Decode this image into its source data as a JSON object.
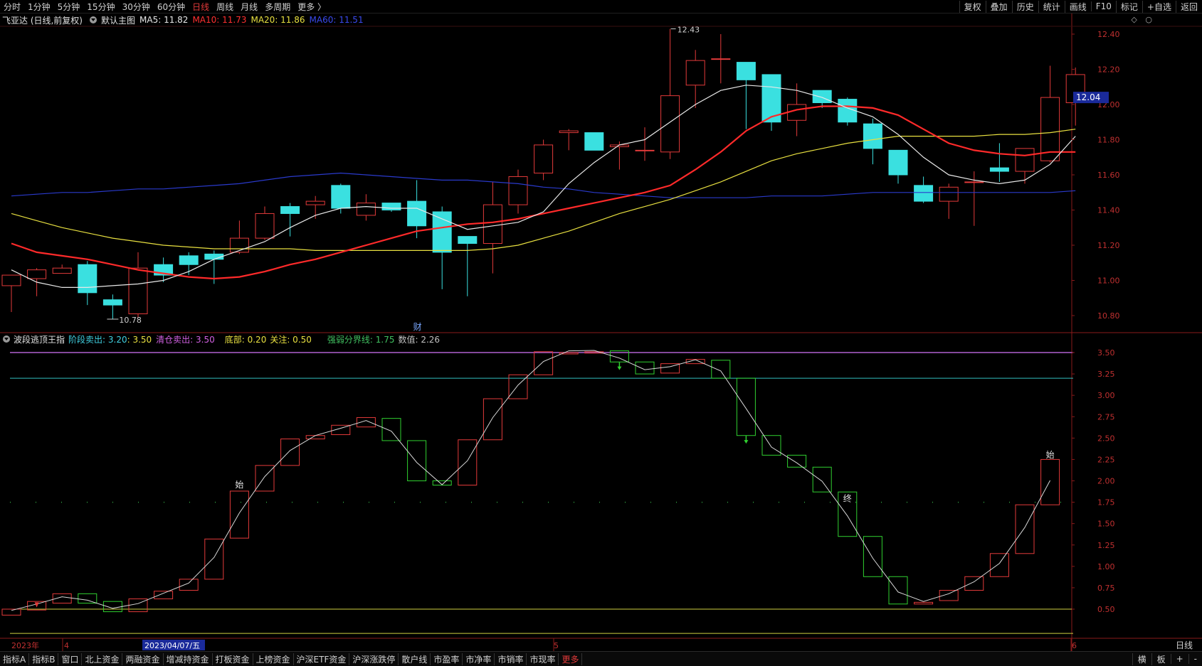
{
  "toolbar": {
    "periods": [
      "分时",
      "1分钟",
      "5分钟",
      "15分钟",
      "30分钟",
      "60分钟",
      "日线",
      "周线",
      "月线",
      "多周期",
      "更多 〉"
    ],
    "active_period": "日线",
    "right_buttons": [
      "复权",
      "叠加",
      "历史",
      "统计",
      "画线",
      "F10",
      "标记",
      "+自选",
      "返回"
    ]
  },
  "main_header": {
    "stock": "飞亚达 (日线,前复权)",
    "template": "默认主图",
    "ma5": "MA5: 11.82",
    "ma10": "MA10: 11.73",
    "ma20": "MA20: 11.86",
    "ma60": "MA60: 11.51",
    "icons": [
      "◇",
      "○"
    ]
  },
  "indicator_header": {
    "name": "波段逃顶王指",
    "stage_sell": "阶段卖出: 3.20",
    "stage_sell_b": ": 3.50",
    "clear_sell": "清仓卖出: 3.50",
    "bottom": "底部: 0.20",
    "focus": "关注: 0.50",
    "divider": "强弱分界线: 1.75",
    "value": "数值: 2.26"
  },
  "colors": {
    "up": "#e23a3a",
    "down": "#3ae0e0",
    "ma5": "#e8e8e8",
    "ma10": "#ff2a2a",
    "ma20": "#e8e040",
    "ma60": "#2a3acc",
    "ind_up": "#e23a3a",
    "ind_down": "#30d030",
    "sell_line": "#b060d0",
    "clear_line": "#30c0c0",
    "focus_line": "#d0d040"
  },
  "price_axis": {
    "ticks": [
      "12.40",
      "12.20",
      "12.00",
      "11.80",
      "11.60",
      "11.40",
      "11.20",
      "11.00",
      "10.80"
    ],
    "last_price": "12.04"
  },
  "ind_axis": {
    "ticks": [
      "3.50",
      "3.25",
      "3.00",
      "2.75",
      "2.50",
      "2.25",
      "2.00",
      "1.75",
      "1.50",
      "1.25",
      "1.00",
      "0.75",
      "0.50"
    ]
  },
  "annotations": {
    "high": "12.43",
    "low": "10.78",
    "cai": "财",
    "shi1": "始",
    "zhong": "终",
    "shi2": "始"
  },
  "date_axis": {
    "year": "2023年",
    "m4": "4",
    "cursor_date": "2023/04/07/五",
    "m5": "5",
    "m6": "6",
    "period_label": "日线"
  },
  "statusbar": {
    "items": [
      "指标A",
      "指标B",
      "窗口",
      "北上资金",
      "两融资金",
      "增减持资金",
      "打板资金",
      "上榜资金",
      "沪深ETF资金",
      "沪深涨跌停",
      "散户线",
      "市盈率",
      "市净率",
      "市销率",
      "市现率",
      "更多"
    ],
    "right": [
      "横",
      "板",
      "+",
      "-"
    ]
  },
  "chart_data": [
    {
      "type": "candlestick",
      "title": "飞亚达 (日线,前复权)",
      "ylim": [
        10.7,
        12.45
      ],
      "candles": [
        {
          "o": 10.97,
          "c": 11.03,
          "h": 11.03,
          "l": 10.82
        },
        {
          "o": 11.01,
          "c": 11.06,
          "h": 11.07,
          "l": 10.91
        },
        {
          "o": 11.04,
          "c": 11.07,
          "h": 11.09,
          "l": 11.04
        },
        {
          "o": 11.09,
          "c": 10.93,
          "h": 11.11,
          "l": 10.86
        },
        {
          "o": 10.89,
          "c": 10.86,
          "h": 10.92,
          "l": 10.78
        },
        {
          "o": 10.81,
          "c": 11.07,
          "h": 11.16,
          "l": 10.79
        },
        {
          "o": 11.09,
          "c": 11.03,
          "h": 11.13,
          "l": 10.99
        },
        {
          "o": 11.14,
          "c": 11.09,
          "h": 11.16,
          "l": 11.03
        },
        {
          "o": 11.15,
          "c": 11.12,
          "h": 11.17,
          "l": 10.98
        },
        {
          "o": 11.16,
          "c": 11.24,
          "h": 11.34,
          "l": 11.15
        },
        {
          "o": 11.24,
          "c": 11.38,
          "h": 11.42,
          "l": 11.23
        },
        {
          "o": 11.42,
          "c": 11.38,
          "h": 11.44,
          "l": 11.25
        },
        {
          "o": 11.43,
          "c": 11.45,
          "h": 11.48,
          "l": 11.35
        },
        {
          "o": 11.54,
          "c": 11.41,
          "h": 11.55,
          "l": 11.38
        },
        {
          "o": 11.37,
          "c": 11.44,
          "h": 11.49,
          "l": 11.34
        },
        {
          "o": 11.44,
          "c": 11.4,
          "h": 11.44,
          "l": 11.39
        },
        {
          "o": 11.45,
          "c": 11.31,
          "h": 11.57,
          "l": 11.24
        },
        {
          "o": 11.39,
          "c": 11.16,
          "h": 11.42,
          "l": 10.95
        },
        {
          "o": 11.25,
          "c": 11.21,
          "h": 11.25,
          "l": 10.91
        },
        {
          "o": 11.21,
          "c": 11.43,
          "h": 11.56,
          "l": 11.04
        },
        {
          "o": 11.43,
          "c": 11.59,
          "h": 11.63,
          "l": 11.38
        },
        {
          "o": 11.61,
          "c": 11.77,
          "h": 11.8,
          "l": 11.57
        },
        {
          "o": 11.84,
          "c": 11.85,
          "h": 11.86,
          "l": 11.74
        },
        {
          "o": 11.84,
          "c": 11.74,
          "h": 11.84,
          "l": 11.74
        },
        {
          "o": 11.76,
          "c": 11.77,
          "h": 11.79,
          "l": 11.63
        },
        {
          "o": 11.74,
          "c": 11.74,
          "h": 11.87,
          "l": 11.68
        },
        {
          "o": 11.73,
          "c": 12.05,
          "h": 12.43,
          "l": 11.69
        },
        {
          "o": 12.11,
          "c": 12.25,
          "h": 12.31,
          "l": 11.98
        },
        {
          "o": 12.26,
          "c": 12.26,
          "h": 12.4,
          "l": 12.12
        },
        {
          "o": 12.24,
          "c": 12.14,
          "h": 12.24,
          "l": 11.86
        },
        {
          "o": 12.17,
          "c": 11.9,
          "h": 12.17,
          "l": 11.85
        },
        {
          "o": 11.91,
          "c": 12.0,
          "h": 12.12,
          "l": 11.82
        },
        {
          "o": 12.08,
          "c": 12.01,
          "h": 12.08,
          "l": 11.98
        },
        {
          "o": 12.03,
          "c": 11.9,
          "h": 12.04,
          "l": 11.88
        },
        {
          "o": 11.89,
          "c": 11.75,
          "h": 11.92,
          "l": 11.66
        },
        {
          "o": 11.74,
          "c": 11.6,
          "h": 11.74,
          "l": 11.55
        },
        {
          "o": 11.54,
          "c": 11.45,
          "h": 11.59,
          "l": 11.44
        },
        {
          "o": 11.45,
          "c": 11.53,
          "h": 11.55,
          "l": 11.35
        },
        {
          "o": 11.56,
          "c": 11.56,
          "h": 11.62,
          "l": 11.31
        },
        {
          "o": 11.64,
          "c": 11.62,
          "h": 11.78,
          "l": 11.56
        },
        {
          "o": 11.62,
          "c": 11.75,
          "h": 11.75,
          "l": 11.55
        },
        {
          "o": 11.68,
          "c": 12.04,
          "h": 12.22,
          "l": 11.67
        },
        {
          "o": 12.01,
          "c": 12.17,
          "h": 12.21,
          "l": 11.88
        }
      ],
      "ma5": [
        11.06,
        10.99,
        10.96,
        10.96,
        10.97,
        10.98,
        11.0,
        11.05,
        11.12,
        11.17,
        11.22,
        11.3,
        11.37,
        11.41,
        11.42,
        11.41,
        11.41,
        11.35,
        11.29,
        11.31,
        11.33,
        11.39,
        11.55,
        11.67,
        11.77,
        11.8,
        11.9,
        12.0,
        12.08,
        12.11,
        12.1,
        12.08,
        12.04,
        11.98,
        11.93,
        11.83,
        11.7,
        11.6,
        11.57,
        11.55,
        11.57,
        11.66,
        11.82
      ],
      "ma10": [
        11.21,
        11.16,
        11.14,
        11.12,
        11.09,
        11.06,
        11.04,
        11.02,
        11.01,
        11.02,
        11.05,
        11.09,
        11.12,
        11.16,
        11.2,
        11.24,
        11.28,
        11.3,
        11.32,
        11.33,
        11.35,
        11.38,
        11.41,
        11.44,
        11.47,
        11.5,
        11.54,
        11.63,
        11.73,
        11.85,
        11.93,
        11.97,
        11.99,
        11.99,
        11.98,
        11.94,
        11.86,
        11.78,
        11.74,
        11.72,
        11.71,
        11.73,
        11.73
      ],
      "ma20": [
        11.38,
        11.34,
        11.3,
        11.27,
        11.24,
        11.22,
        11.2,
        11.19,
        11.18,
        11.18,
        11.18,
        11.18,
        11.17,
        11.17,
        11.17,
        11.17,
        11.17,
        11.17,
        11.17,
        11.18,
        11.2,
        11.24,
        11.28,
        11.33,
        11.38,
        11.42,
        11.46,
        11.51,
        11.56,
        11.62,
        11.68,
        11.72,
        11.75,
        11.78,
        11.8,
        11.82,
        11.82,
        11.82,
        11.82,
        11.83,
        11.83,
        11.84,
        11.86
      ],
      "ma60": [
        11.48,
        11.49,
        11.5,
        11.5,
        11.51,
        11.52,
        11.52,
        11.53,
        11.54,
        11.55,
        11.57,
        11.59,
        11.6,
        11.61,
        11.6,
        11.59,
        11.58,
        11.57,
        11.57,
        11.56,
        11.55,
        11.53,
        11.52,
        11.5,
        11.49,
        11.48,
        11.47,
        11.47,
        11.47,
        11.47,
        11.48,
        11.48,
        11.48,
        11.49,
        11.5,
        11.5,
        11.5,
        11.5,
        11.5,
        11.5,
        11.5,
        11.5,
        11.51
      ]
    },
    {
      "type": "candlestick",
      "title": "波段逃顶王指",
      "ylim": [
        0.2,
        3.6
      ],
      "boxes": [
        {
          "a": 0.43,
          "b": 0.5
        },
        {
          "a": 0.49,
          "b": 0.59
        },
        {
          "a": 0.57,
          "b": 0.68
        },
        {
          "a": 0.68,
          "b": 0.57
        },
        {
          "a": 0.59,
          "b": 0.47
        },
        {
          "a": 0.47,
          "b": 0.62
        },
        {
          "a": 0.62,
          "b": 0.71
        },
        {
          "a": 0.72,
          "b": 0.85
        },
        {
          "a": 0.85,
          "b": 1.32
        },
        {
          "a": 1.33,
          "b": 1.88
        },
        {
          "a": 1.88,
          "b": 2.18
        },
        {
          "a": 2.18,
          "b": 2.49
        },
        {
          "a": 2.49,
          "b": 2.53
        },
        {
          "a": 2.54,
          "b": 2.65
        },
        {
          "a": 2.63,
          "b": 2.74
        },
        {
          "a": 2.73,
          "b": 2.47
        },
        {
          "a": 2.47,
          "b": 2.0
        },
        {
          "a": 2.0,
          "b": 1.95
        },
        {
          "a": 1.95,
          "b": 2.48
        },
        {
          "a": 2.48,
          "b": 2.96
        },
        {
          "a": 2.96,
          "b": 3.24
        },
        {
          "a": 3.24,
          "b": 3.51
        },
        {
          "a": 3.5,
          "b": 3.5
        },
        {
          "a": 3.5,
          "b": 3.51
        },
        {
          "a": 3.52,
          "b": 3.39
        },
        {
          "a": 3.39,
          "b": 3.25
        },
        {
          "a": 3.26,
          "b": 3.37
        },
        {
          "a": 3.37,
          "b": 3.42
        },
        {
          "a": 3.41,
          "b": 3.2
        },
        {
          "a": 3.2,
          "b": 2.53
        },
        {
          "a": 2.53,
          "b": 2.3
        },
        {
          "a": 2.3,
          "b": 2.16
        },
        {
          "a": 2.16,
          "b": 1.87
        },
        {
          "a": 1.87,
          "b": 1.35
        },
        {
          "a": 1.35,
          "b": 0.88
        },
        {
          "a": 0.88,
          "b": 0.56
        },
        {
          "a": 0.56,
          "b": 0.58
        },
        {
          "a": 0.6,
          "b": 0.72
        },
        {
          "a": 0.72,
          "b": 0.88
        },
        {
          "a": 0.88,
          "b": 1.15
        },
        {
          "a": 1.15,
          "b": 1.72
        },
        {
          "a": 1.72,
          "b": 2.25
        }
      ],
      "levels": {
        "stage_sell": 3.2,
        "clear_sell": 3.5,
        "bottom": 0.2,
        "focus": 0.5,
        "divider": 1.75
      }
    }
  ]
}
